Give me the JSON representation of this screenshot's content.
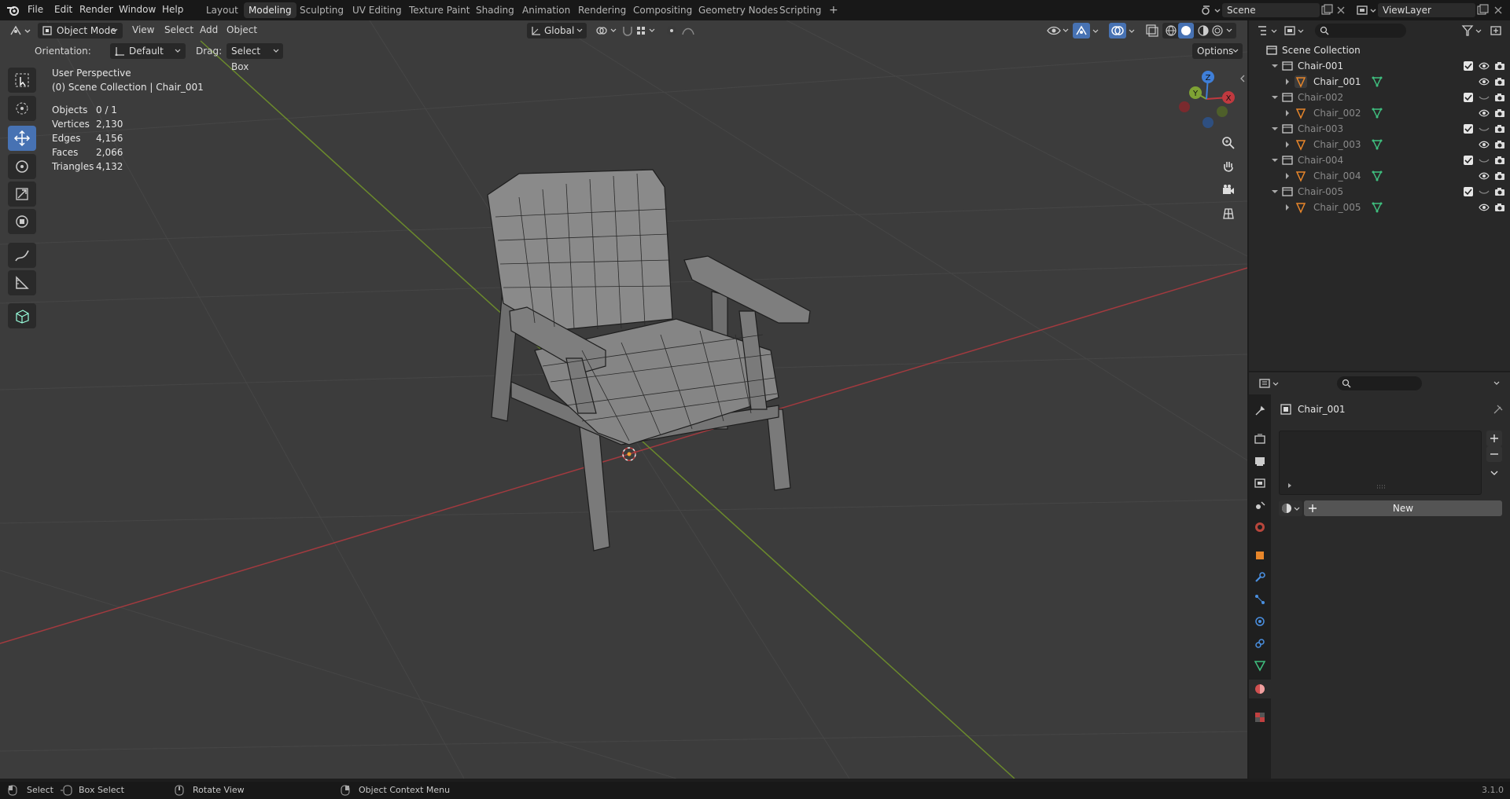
{
  "topbar": {
    "menus": [
      "File",
      "Edit",
      "Render",
      "Window",
      "Help"
    ],
    "workspaces": [
      "Layout",
      "Modeling",
      "Sculpting",
      "UV Editing",
      "Texture Paint",
      "Shading",
      "Animation",
      "Rendering",
      "Compositing",
      "Geometry Nodes",
      "Scripting"
    ],
    "active_workspace": "Modeling",
    "add_workspace": "+",
    "scene_label": "Scene",
    "viewlayer_label": "ViewLayer"
  },
  "viewport_header": {
    "mode": "Object Mode",
    "menus": [
      "View",
      "Select",
      "Add",
      "Object"
    ],
    "transform_orientation": "Global",
    "orientation_label": "Orientation:",
    "orientation_value": "Default",
    "drag_label": "Drag:",
    "drag_value": "Select Box",
    "options_label": "Options"
  },
  "overlay": {
    "view_name": "User Perspective",
    "collection_line": "(0) Scene Collection | Chair_001",
    "stats": [
      {
        "label": "Objects",
        "value": "0 / 1"
      },
      {
        "label": "Vertices",
        "value": "2,130"
      },
      {
        "label": "Edges",
        "value": "4,156"
      },
      {
        "label": "Faces",
        "value": "2,066"
      },
      {
        "label": "Triangles",
        "value": "4,132"
      }
    ]
  },
  "gizmo": {
    "x": "X",
    "y": "Y",
    "z": "Z"
  },
  "outliner": {
    "root": "Scene Collection",
    "collections": [
      {
        "name": "Chair-001",
        "object": "Chair_001",
        "dim": false
      },
      {
        "name": "Chair-002",
        "object": "Chair_002",
        "dim": true
      },
      {
        "name": "Chair-003",
        "object": "Chair_003",
        "dim": true
      },
      {
        "name": "Chair-004",
        "object": "Chair_004",
        "dim": true
      },
      {
        "name": "Chair-005",
        "object": "Chair_005",
        "dim": true
      }
    ]
  },
  "properties": {
    "object_name": "Chair_001",
    "new_button": "New"
  },
  "statusbar": {
    "items": [
      "Select",
      "Box Select",
      "Rotate View",
      "Object Context Menu"
    ],
    "version": "3.1.0"
  },
  "colors": {
    "x_axis": "#c0393f",
    "y_axis": "#7ea234",
    "z_axis": "#3f7fd8",
    "accent": "#4772b3"
  }
}
